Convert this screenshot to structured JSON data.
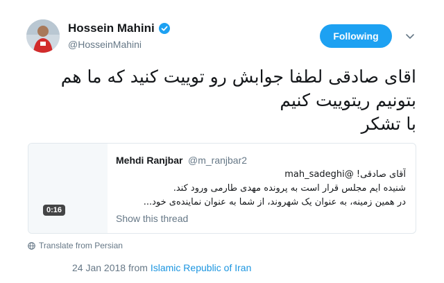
{
  "author": {
    "display_name": "Hossein Mahini",
    "handle": "@HosseinMahini",
    "verified": true
  },
  "follow_button": {
    "label": "Following"
  },
  "tweet": {
    "lines": [
      "اقای صادقی لطفا جوابش رو توییت کنید که ما هم",
      "بتونیم ریتوییت کنیم",
      "با تشکر"
    ]
  },
  "quoted_tweet": {
    "display_name": "Mehdi Ranjbar",
    "handle": "@m_ranjbar2",
    "lines": [
      "آقای صادقی! @mah_sadeghi",
      "شنیده ایم مجلس قرار است به پرونده مهدی طارمی ورود کند.",
      "در همین زمینه، به عنوان یک شهروند، از شما به عنوان نماینده‌ی خود..."
    ],
    "video_duration": "0:16",
    "show_thread_label": "Show this thread"
  },
  "translate_label": "Translate from Persian",
  "timestamp": {
    "date_text": "24 Jan 2018 from",
    "place": "Islamic Republic of Iran"
  },
  "colors": {
    "accent": "#1da1f2",
    "link": "#1b95e0",
    "muted": "#657786",
    "text": "#14171a",
    "border": "#e1e8ed"
  },
  "icons": [
    "verified-badge-icon",
    "chevron-down-icon",
    "globe-icon"
  ]
}
